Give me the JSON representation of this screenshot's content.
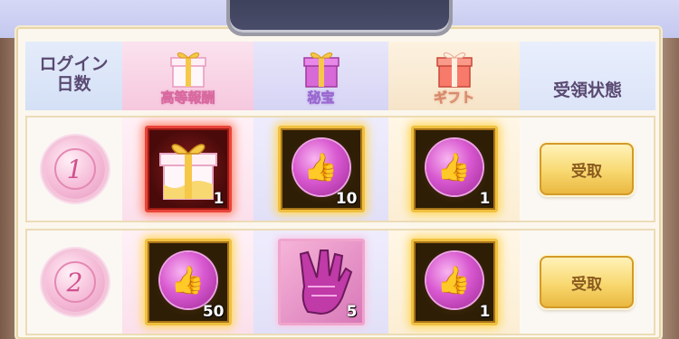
{
  "header": {
    "days_label_line1": "ログイン",
    "days_label_line2": "日数",
    "col1_label": "高等報酬",
    "col2_label": "秘宝",
    "col3_label": "ギフト",
    "status_label": "受領状態"
  },
  "rows": [
    {
      "day": "1",
      "items": [
        {
          "icon": "gift-box-icon",
          "qty": "1"
        },
        {
          "icon": "pink-coin-icon",
          "qty": "10"
        },
        {
          "icon": "pink-coin-icon",
          "qty": "1"
        }
      ],
      "button_label": "受取"
    },
    {
      "day": "2",
      "items": [
        {
          "icon": "pink-coin-icon",
          "qty": "50"
        },
        {
          "icon": "pink-glove-icon",
          "qty": "5"
        },
        {
          "icon": "pink-coin-icon",
          "qty": "1"
        }
      ],
      "button_label": "受取"
    }
  ],
  "colors": {
    "accent_pink": "#e89ac0",
    "button_gold": "#f8d870",
    "frame_gold": "#f0c040",
    "frame_red": "#e8453a"
  }
}
